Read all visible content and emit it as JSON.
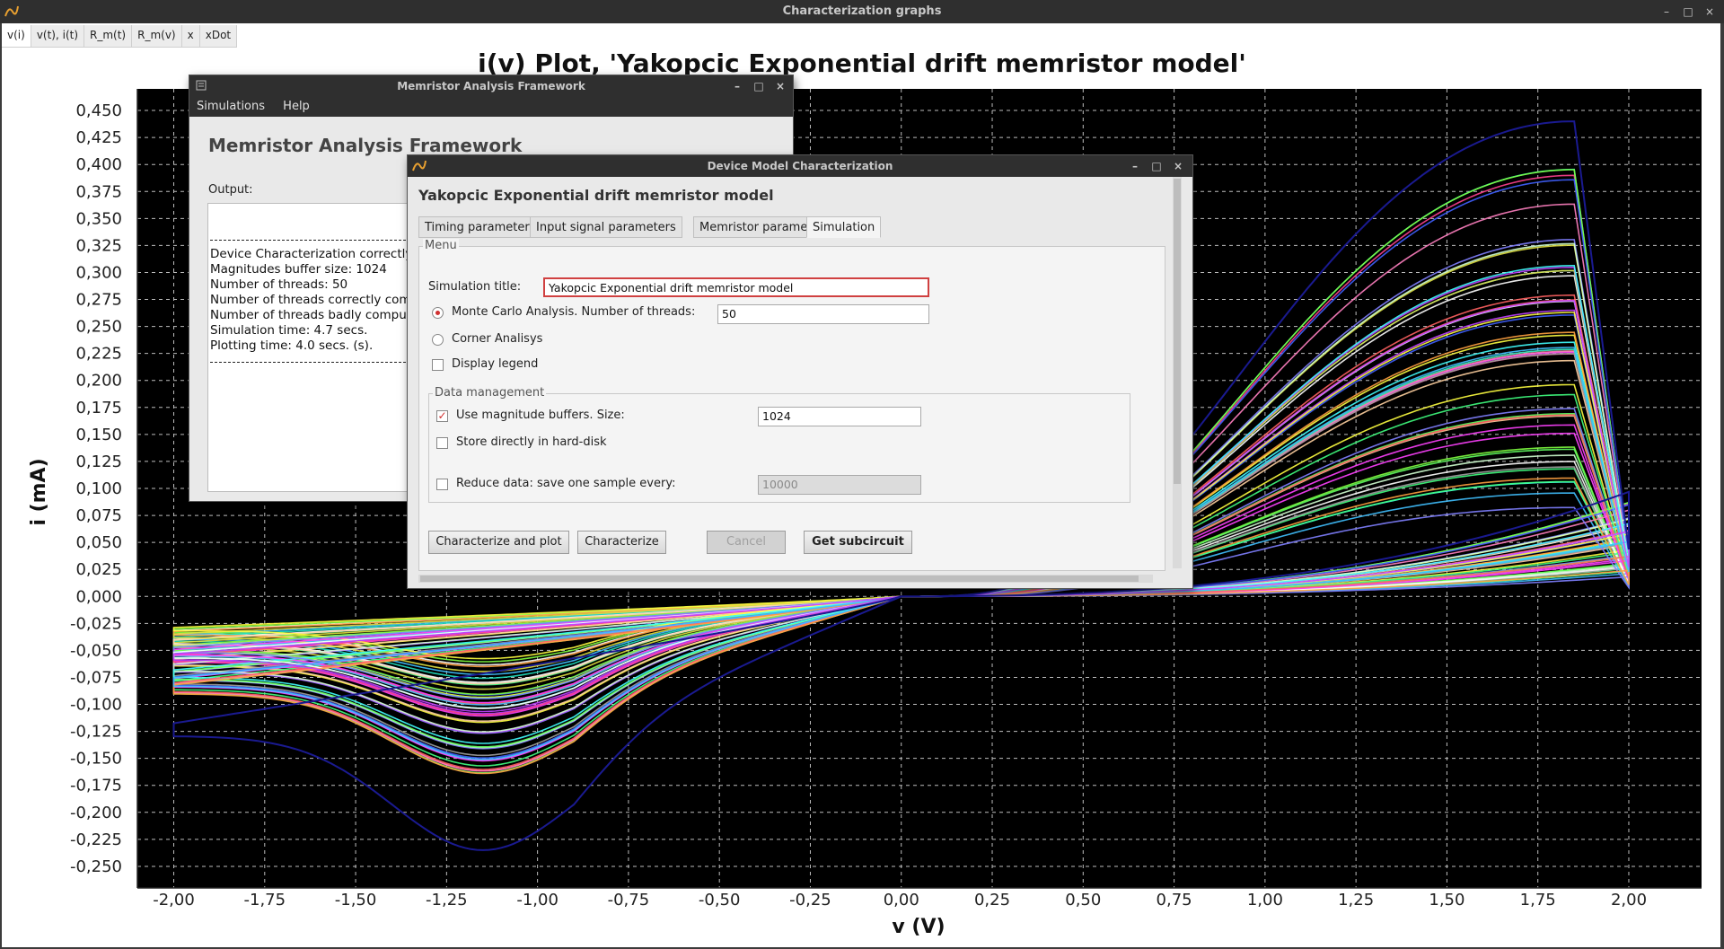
{
  "window": {
    "title": "Characterization graphs",
    "tabs": [
      "v(i)",
      "v(t), i(t)",
      "R_m(t)",
      "R_m(v)",
      "x",
      "xDot"
    ],
    "active_tab": 0,
    "controls": {
      "minimize": "–",
      "maximize": "□",
      "close": "×"
    }
  },
  "chart_data": {
    "type": "line",
    "title": "i(v)  Plot, 'Yakopcic Exponential drift memristor model'",
    "xlabel": "v (V)",
    "ylabel": "i (mA)",
    "xlim": [
      -2.1,
      2.2
    ],
    "ylim": [
      -0.27,
      0.47
    ],
    "x_ticks": [
      "-2,00",
      "-1,75",
      "-1,50",
      "-1,25",
      "-1,00",
      "-0,75",
      "-0,50",
      "-0,25",
      "0,00",
      "0,25",
      "0,50",
      "0,75",
      "1,00",
      "1,25",
      "1,50",
      "1,75",
      "2,00"
    ],
    "y_ticks": [
      "0,450",
      "0,425",
      "0,400",
      "0,375",
      "0,350",
      "0,325",
      "0,300",
      "0,275",
      "0,250",
      "0,225",
      "0,200",
      "0,175",
      "0,150",
      "0,125",
      "0,100",
      "0,075",
      "0,050",
      "0,025",
      "0,000",
      "-0,025",
      "-0,050",
      "-0,075",
      "-0,100",
      "-0,125",
      "-0,150",
      "-0,175",
      "-0,200",
      "-0,225",
      "-0,250"
    ],
    "grid": true,
    "background": "#000000",
    "series_count": 50,
    "outer_loop": {
      "peak_positive": {
        "v": 1.85,
        "i": 0.44
      },
      "peak_negative": {
        "v": -1.15,
        "i": -0.235
      }
    },
    "positive_peak_range": [
      0.08,
      0.41
    ],
    "negative_trough_range": [
      -0.165,
      -0.055
    ]
  },
  "maf": {
    "title": "Memristor Analysis Framework",
    "menu": [
      "Simulations",
      "Help"
    ],
    "heading": "Memristor Analysis Framework",
    "output_label": "Output:",
    "output_lines": [
      "Device Characterization correctly",
      "Magnitudes buffer size: 1024",
      "Number of threads: 50",
      "Number of threads correctly comp",
      "Number of threads badly compute",
      "Simulation time: 4.7 secs.",
      "Plotting time: 4.0 secs. (s)."
    ]
  },
  "dmc": {
    "title": "Device Model Characterization",
    "heading": "Yakopcic Exponential drift memristor model",
    "tabs": [
      "Timing parameters",
      "Input signal parameters",
      "Memristor parameters",
      "Simulation"
    ],
    "active_tab": 3,
    "menu_group": "Menu",
    "sim_title_label": "Simulation title:",
    "sim_title_value": "Yakopcic Exponential drift memristor model",
    "monte_carlo_label": "Monte Carlo Analysis. Number of threads:",
    "monte_carlo_selected": true,
    "threads_value": "50",
    "corner_label": "Corner Analisys",
    "legend_label": "Display legend",
    "data_group": "Data management",
    "buffers_label": "Use magnitude buffers. Size:",
    "buffers_checked": true,
    "buffers_value": "1024",
    "hdd_label": "Store directly in hard-disk",
    "reduce_label": "Reduce data: save one sample every:",
    "reduce_value": "10000",
    "buttons": {
      "char_plot": "Characterize and plot",
      "char": "Characterize",
      "cancel": "Cancel",
      "subcircuit": "Get subcircuit"
    }
  }
}
